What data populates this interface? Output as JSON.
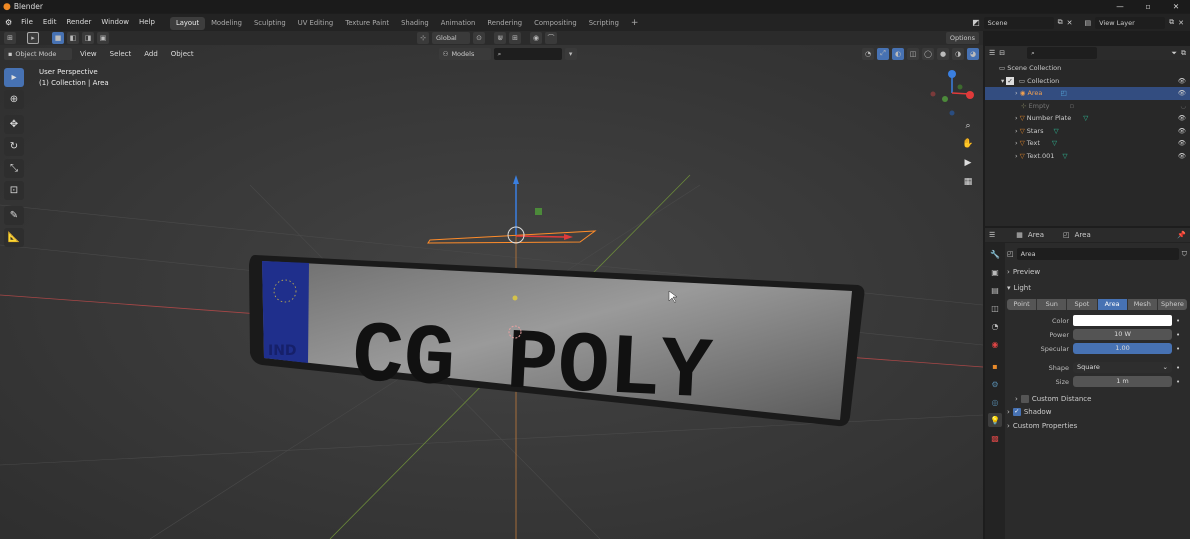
{
  "app": {
    "title": "Blender"
  },
  "menus": [
    "File",
    "Edit",
    "Render",
    "Window",
    "Help"
  ],
  "workspaces": [
    "Layout",
    "Modeling",
    "Sculpting",
    "UV Editing",
    "Texture Paint",
    "Shading",
    "Animation",
    "Rendering",
    "Compositing",
    "Scripting"
  ],
  "active_workspace": "Layout",
  "scene": {
    "label": "Scene",
    "view_layer": "View Layer"
  },
  "viewport_header": {
    "mode": "Object Mode",
    "menus": [
      "View",
      "Select",
      "Add",
      "Object"
    ],
    "orientation": "Global",
    "options": "Options",
    "editor_menu": "Models"
  },
  "viewport": {
    "perspective": "User Perspective",
    "collection_info": "(1) Collection | Area",
    "plate_text": "CG POLY",
    "plate_badge": "IND"
  },
  "outliner": {
    "root": "Scene Collection",
    "collection": "Collection",
    "items": [
      "Area",
      "Empty",
      "Number Plate",
      "Stars",
      "Text",
      "Text.001"
    ]
  },
  "properties": {
    "header_object": "Area",
    "header_data": "Area",
    "datablock": "Area",
    "panels": {
      "preview": "Preview",
      "light": "Light",
      "custom_distance": "Custom Distance",
      "shadow": "Shadow",
      "custom_properties": "Custom Properties"
    },
    "light_types": [
      "Point",
      "Sun",
      "Spot",
      "Area",
      "Mesh",
      "Sphere"
    ],
    "active_light_type": "Area",
    "fields": {
      "color_label": "Color",
      "power_label": "Power",
      "power_value": "10 W",
      "specular_label": "Specular",
      "specular_value": "1.00",
      "shape_label": "Shape",
      "shape_value": "Square",
      "size_label": "Size",
      "size_value": "1 m"
    },
    "colors": {
      "accent": "#4772b3",
      "selected_row": "#334d80",
      "light_color": "#ffffff"
    }
  }
}
